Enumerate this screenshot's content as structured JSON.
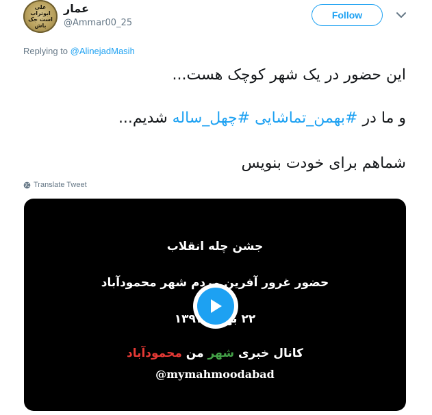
{
  "colors": {
    "accent": "#1da1f2",
    "text": "#14171a",
    "muted": "#657786",
    "video_bg": "#000000",
    "video_red": "#e53935",
    "video_green": "#43a047"
  },
  "avatar": {
    "text": "علی ابوتراب است جک باش"
  },
  "user": {
    "display_name": "عمار",
    "handle": "@Ammar00_25"
  },
  "follow_button": {
    "label": "Follow"
  },
  "menu": {
    "icon": "chevron-down-icon"
  },
  "reply": {
    "prefix": "Replying to",
    "mention": "@AlinejadMasih"
  },
  "tweet": {
    "line1": "این حضور در یک شهر کوچک هست...",
    "line2_prefix": "و ما در",
    "hashtag1": "#بهمن_تماشایی",
    "hashtag2": "#چهل_ساله",
    "line2_suffix": "شدیم...",
    "line3": "شماهم برای خودت بنویس"
  },
  "translate": {
    "icon": "globe-icon",
    "label": "Translate Tweet"
  },
  "video": {
    "title": "جشن چله انقلاب",
    "subtitle": "حضور غرور آفرین مردم شهر محمودآباد",
    "date": "۲۲ بهمن ۱۳۹۷",
    "channel_prefix": "کانال خبری",
    "channel_green": "شهر",
    "channel_white": "من",
    "channel_red": "محمودآباد",
    "handle": "@mymahmoodabad",
    "play_icon": "play-icon"
  }
}
